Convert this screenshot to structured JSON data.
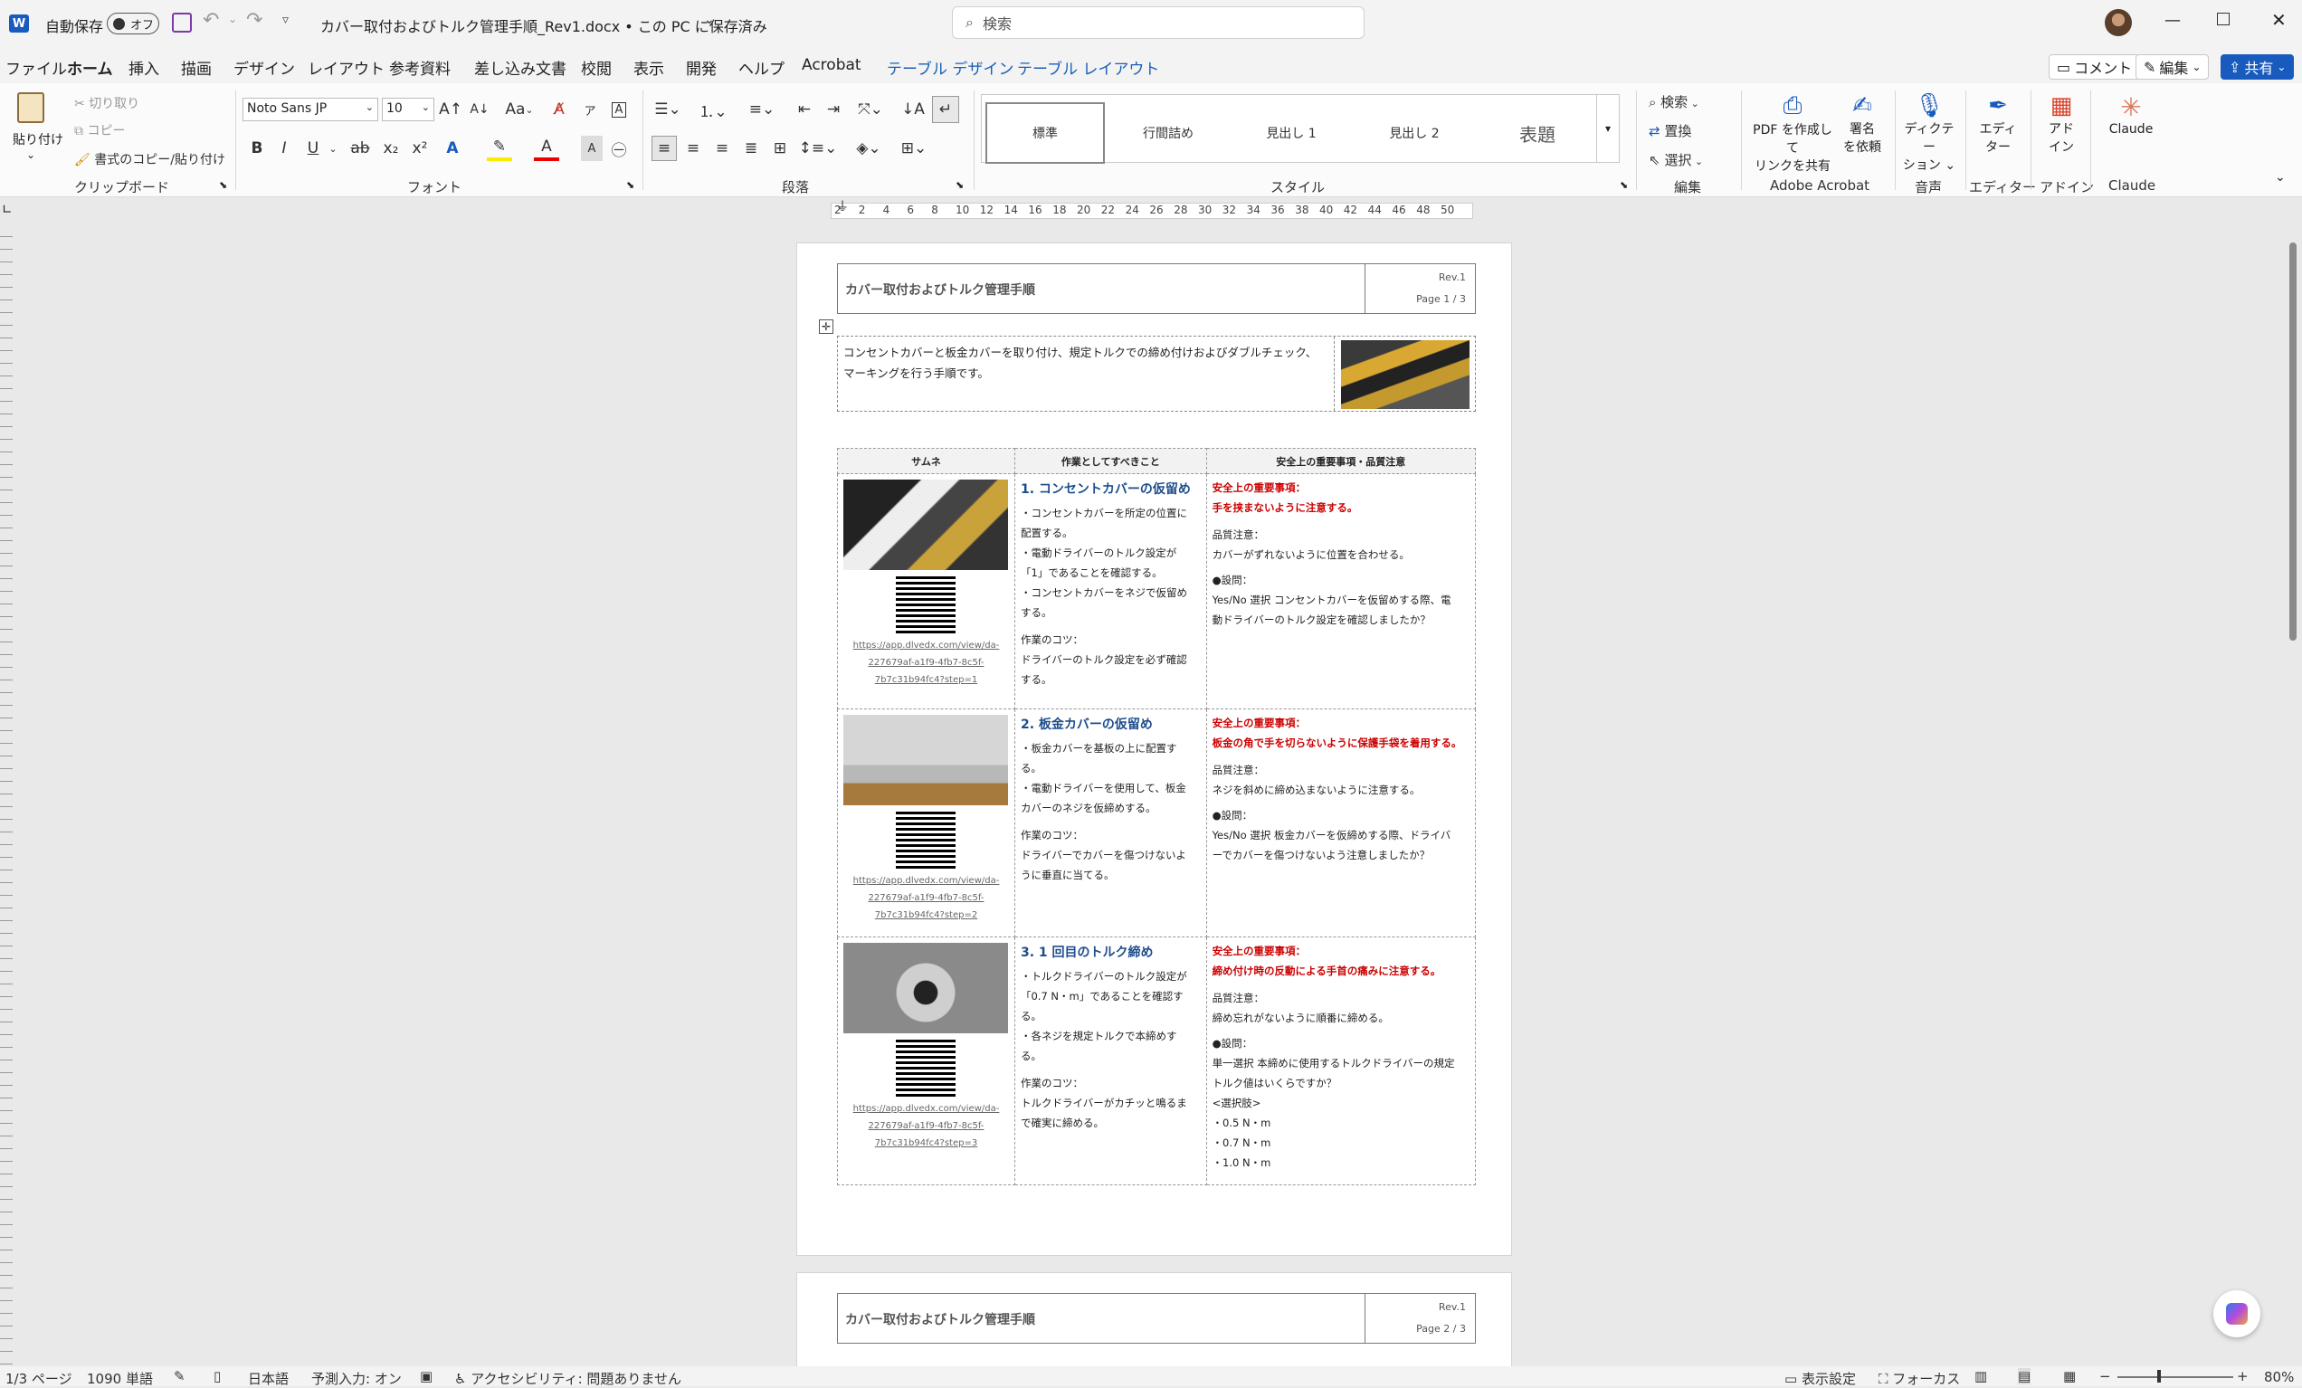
{
  "titlebar": {
    "autosave_label": "自動保存",
    "autosave_state": "オフ",
    "doc_title": "カバー取付およびトルク管理手順_Rev1.docx • この PC に保存済み",
    "search_placeholder": "検索"
  },
  "tabs": [
    "ファイル",
    "ホーム",
    "挿入",
    "描画",
    "デザイン",
    "レイアウト",
    "参考資料",
    "差し込み文書",
    "校閲",
    "表示",
    "開発",
    "ヘルプ",
    "Acrobat",
    "テーブル デザイン",
    "テーブル レイアウト"
  ],
  "tab_right": {
    "comment": "コメント",
    "edit": "編集",
    "share": "共有"
  },
  "clipboard": {
    "paste": "貼り付け",
    "cut": "切り取り",
    "copy": "コピー",
    "format_painter": "書式のコピー/貼り付け",
    "label": "クリップボード"
  },
  "font": {
    "name": "Noto Sans JP",
    "size": "10",
    "label": "フォント",
    "case": "Aa"
  },
  "paragraph": {
    "label": "段落"
  },
  "styles": {
    "items": [
      "標準",
      "行間詰め",
      "見出し 1",
      "見出し 2",
      "表題"
    ],
    "label": "スタイル"
  },
  "editing": {
    "find": "検索",
    "replace": "置換",
    "select": "選択",
    "label": "編集"
  },
  "acrobat": {
    "pdf": "PDF を作成して",
    "pdf2": "リンクを共有",
    "sign": "署名",
    "sign2": "を依頼",
    "label": "Adobe Acrobat"
  },
  "voice": {
    "dictate": "ディクテー",
    "dictate2": "ション",
    "label": "音声"
  },
  "editor": {
    "name": "エディ",
    "name2": "ター",
    "label": "エディター"
  },
  "addins": {
    "name": "アド",
    "name2": "イン",
    "label": "アドイン"
  },
  "claude": {
    "name": "Claude",
    "label": "Claude"
  },
  "ruler_numbers": [
    "2",
    "2",
    "4",
    "6",
    "8",
    "10",
    "12",
    "14",
    "16",
    "18",
    "20",
    "22",
    "24",
    "26",
    "28",
    "30",
    "32",
    "34",
    "36",
    "38",
    "40",
    "42",
    "44",
    "46",
    "48",
    "50"
  ],
  "document": {
    "header_title": "カバー取付およびトルク管理手順",
    "rev": "Rev.1",
    "page1": "Page 1 / 3",
    "page2": "Page 2 / 3",
    "intro": "コンセントカバーと板金カバーを取り付け、規定トルクでの締め付けおよびダブルチェック、マーキングを行う手順です。",
    "col_headers": [
      "サムネ",
      "作業としてすべきこと",
      "安全上の重要事項・品質注意"
    ],
    "rows": [
      {
        "link1": "https://app.dlvedx.com/view/da-",
        "link2": "227679af-a1f9-4fb7-8c5f-",
        "link3": "7b7c31b94fc4?step=1",
        "title": "1. コンセントカバーの仮留め",
        "tasks": [
          "・コンセントカバーを所定の位置に",
          "配置する。",
          "・電動ドライバーのトルク設定が",
          "「1」であることを確認する。",
          "・コンセントカバーをネジで仮留め",
          "する。"
        ],
        "tips_label": "作業のコツ：",
        "tips": [
          "ドライバーのトルク設定を必ず確認",
          "する。"
        ],
        "safety_label": "安全上の重要事項：",
        "safety": "手を挟まないように注意する。",
        "quality_label": "品質注意：",
        "quality": "カバーがずれないように位置を合わせる。",
        "q_label": "●設問：",
        "question": [
          "Yes/No 選択 コンセントカバーを仮留めする際、電",
          "動ドライバーのトルク設定を確認しましたか？"
        ]
      },
      {
        "link1": "https://app.dlvedx.com/view/da-",
        "link2": "227679af-a1f9-4fb7-8c5f-",
        "link3": "7b7c31b94fc4?step=2",
        "title": "2. 板金カバーの仮留め",
        "tasks": [
          "・板金カバーを基板の上に配置す",
          "る。",
          "・電動ドライバーを使用して、板金",
          "カバーのネジを仮締めする。"
        ],
        "tips_label": "作業のコツ：",
        "tips": [
          "ドライバーでカバーを傷つけないよ",
          "うに垂直に当てる。"
        ],
        "safety_label": "安全上の重要事項：",
        "safety": "板金の角で手を切らないように保護手袋を着用する。",
        "quality_label": "品質注意：",
        "quality": "ネジを斜めに締め込まないように注意する。",
        "q_label": "●設問：",
        "question": [
          "Yes/No 選択 板金カバーを仮締めする際、ドライバ",
          "ーでカバーを傷つけないよう注意しましたか？"
        ]
      },
      {
        "link1": "https://app.dlvedx.com/view/da-",
        "link2": "227679af-a1f9-4fb7-8c5f-",
        "link3": "7b7c31b94fc4?step=3",
        "title": "3. 1 回目のトルク締め",
        "tasks": [
          "・トルクドライバーのトルク設定が",
          "「0.7 N・m」であることを確認す",
          "る。",
          "・各ネジを規定トルクで本締めす",
          "る。"
        ],
        "tips_label": "作業のコツ：",
        "tips": [
          "トルクドライバーがカチッと鳴るま",
          "で確実に締める。"
        ],
        "safety_label": "安全上の重要事項：",
        "safety": "締め付け時の反動による手首の痛みに注意する。",
        "quality_label": "品質注意：",
        "quality": "締め忘れがないように順番に締める。",
        "q_label": "●設問：",
        "question": [
          "単一選択 本締めに使用するトルクドライバーの規定",
          "トルク値はいくらですか？",
          "<選択肢>",
          "・0.5 N・m",
          "・0.7 N・m",
          "・1.0 N・m"
        ]
      }
    ]
  },
  "status": {
    "page": "1/3 ページ",
    "words": "1090 単語",
    "lang": "日本語",
    "predict": "予測入力: オン",
    "access": "アクセシビリティ: 問題ありません",
    "display": "表示設定",
    "focus": "フォーカス",
    "zoom": "80%"
  }
}
